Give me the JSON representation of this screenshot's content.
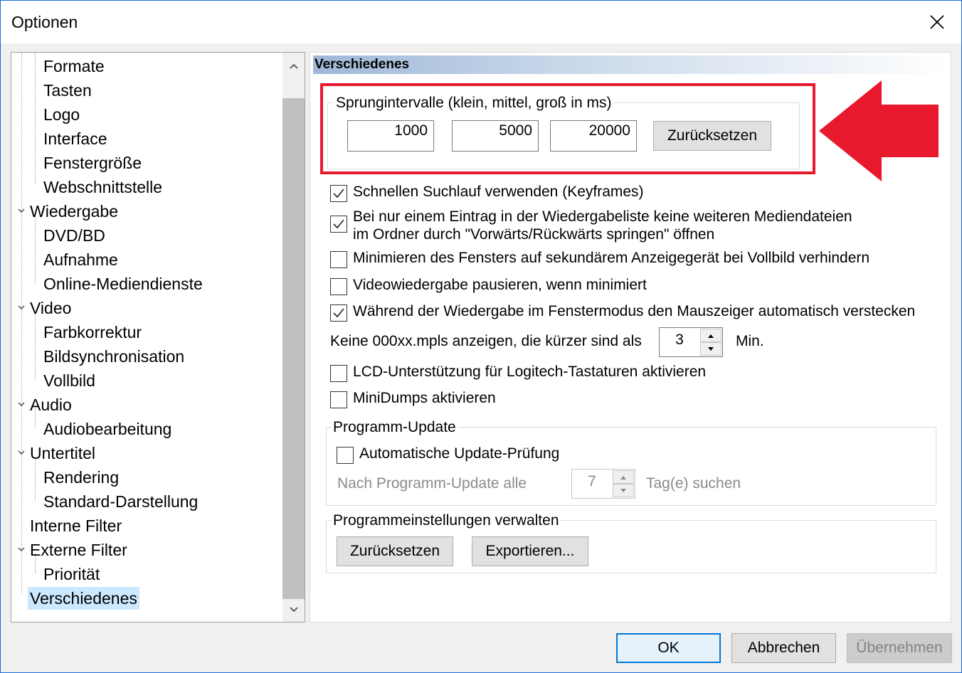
{
  "window": {
    "title": "Optionen"
  },
  "tree": {
    "items": [
      {
        "label": "Formate",
        "level": 1
      },
      {
        "label": "Tasten",
        "level": 1
      },
      {
        "label": "Logo",
        "level": 1
      },
      {
        "label": "Interface",
        "level": 1
      },
      {
        "label": "Fenstergröße",
        "level": 1
      },
      {
        "label": "Webschnittstelle",
        "level": 1
      },
      {
        "label": "Wiedergabe",
        "level": 0
      },
      {
        "label": "DVD/BD",
        "level": 1
      },
      {
        "label": "Aufnahme",
        "level": 1
      },
      {
        "label": "Online-Mediendienste",
        "level": 1
      },
      {
        "label": "Video",
        "level": 0
      },
      {
        "label": "Farbkorrektur",
        "level": 1
      },
      {
        "label": "Bildsynchronisation",
        "level": 1
      },
      {
        "label": "Vollbild",
        "level": 1
      },
      {
        "label": "Audio",
        "level": 0
      },
      {
        "label": "Audiobearbeitung",
        "level": 1
      },
      {
        "label": "Untertitel",
        "level": 0
      },
      {
        "label": "Rendering",
        "level": 1
      },
      {
        "label": "Standard-Darstellung",
        "level": 1
      },
      {
        "label": "Interne Filter",
        "level": 0
      },
      {
        "label": "Externe Filter",
        "level": 0
      },
      {
        "label": "Priorität",
        "level": 1
      },
      {
        "label": "Verschiedenes",
        "level": 0
      }
    ]
  },
  "panel": {
    "header": "Verschiedenes",
    "jump": {
      "group_label": "Sprungintervalle (klein, mittel, groß in ms)",
      "small": "1000",
      "medium": "5000",
      "large": "20000",
      "reset_label": "Zurücksetzen"
    },
    "options": {
      "fast_seek": "Schnellen Suchlauf verwenden (Keyframes)",
      "single_entry_line1": "Bei nur einem Eintrag in der Wiedergabeliste keine weiteren Mediendateien",
      "single_entry_line2": "im Ordner durch \"Vorwärts/Rückwärts springen\" öffnen",
      "minimize_secondary": "Minimieren des Fensters auf sekundärem Anzeigegerät bei Vollbild verhindern",
      "pause_minimized": "Videowiedergabe pausieren, wenn minimiert",
      "hide_cursor": "Während der Wiedergabe im Fenstermodus den Mauszeiger automatisch verstecken",
      "mpls_label": "Keine 000xx.mpls anzeigen, die kürzer sind als",
      "mpls_value": "3",
      "mpls_unit": "Min.",
      "lcd": "LCD-Unterstützung für Logitech-Tastaturen aktivieren",
      "minidumps": "MiniDumps aktivieren"
    },
    "update": {
      "group_label": "Programm-Update",
      "auto_check": "Automatische Update-Prüfung",
      "interval_label": "Nach Programm-Update alle",
      "interval_value": "7",
      "interval_unit": "Tag(e) suchen"
    },
    "settings": {
      "group_label": "Programmeinstellungen verwalten",
      "reset_label": "Zurücksetzen",
      "export_label": "Exportieren..."
    }
  },
  "footer": {
    "ok_label": "OK",
    "cancel_label": "Abbrechen",
    "apply_label": "Übernehmen"
  },
  "colors": {
    "highlight": "#e8192c",
    "selection": "#cce8ff",
    "accent": "#0078d7"
  }
}
